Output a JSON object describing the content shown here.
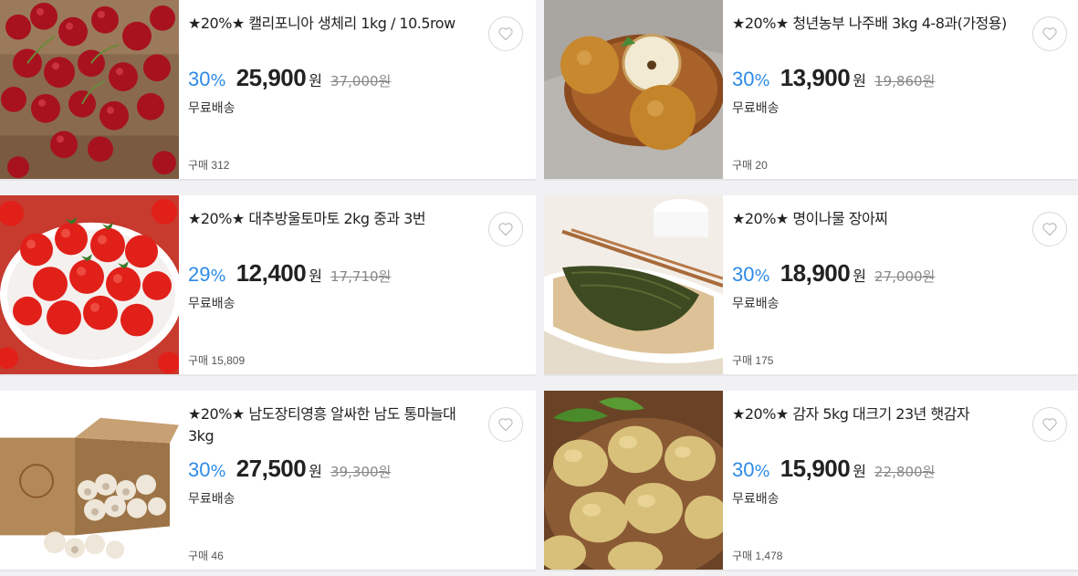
{
  "products": [
    {
      "title": "★20%★ 캘리포니아 생체리 1kg / 10.5row",
      "discount": "30",
      "discount_unit": "%",
      "price": "25,900",
      "currency": "원",
      "original_price": "37,000원",
      "shipping": "무료배송",
      "purchase_count": "구매 312",
      "image": "cherries"
    },
    {
      "title": "★20%★ 청년농부 나주배 3kg 4-8과(가정용)",
      "discount": "30",
      "discount_unit": "%",
      "price": "13,900",
      "currency": "원",
      "original_price": "19,860원",
      "shipping": "무료배송",
      "purchase_count": "구매 20",
      "image": "pears"
    },
    {
      "title": "★20%★ 대추방울토마토 2kg 중과 3번",
      "discount": "29",
      "discount_unit": "%",
      "price": "12,400",
      "currency": "원",
      "original_price": "17,710원",
      "shipping": "무료배송",
      "purchase_count": "구매 15,809",
      "image": "tomatoes"
    },
    {
      "title": "★20%★ 명이나물 장아찌",
      "discount": "30",
      "discount_unit": "%",
      "price": "18,900",
      "currency": "원",
      "original_price": "27,000원",
      "shipping": "무료배송",
      "purchase_count": "구매 175",
      "image": "pickled-greens"
    },
    {
      "title": "★20%★ 남도장티영흥 알싸한 남도 통마늘대 3kg",
      "discount": "30",
      "discount_unit": "%",
      "price": "27,500",
      "currency": "원",
      "original_price": "39,300원",
      "shipping": "무료배송",
      "purchase_count": "구매 46",
      "image": "garlic-box"
    },
    {
      "title": "★20%★ 감자 5kg 대크기 23년 햇감자",
      "discount": "30",
      "discount_unit": "%",
      "price": "15,900",
      "currency": "원",
      "original_price": "22,800원",
      "shipping": "무료배송",
      "purchase_count": "구매 1,478",
      "image": "potatoes"
    }
  ],
  "icons": {
    "wishlist": "heart-outline-icon"
  },
  "colors": {
    "discount": "#2e8be6",
    "background": "#f1f1f3"
  }
}
